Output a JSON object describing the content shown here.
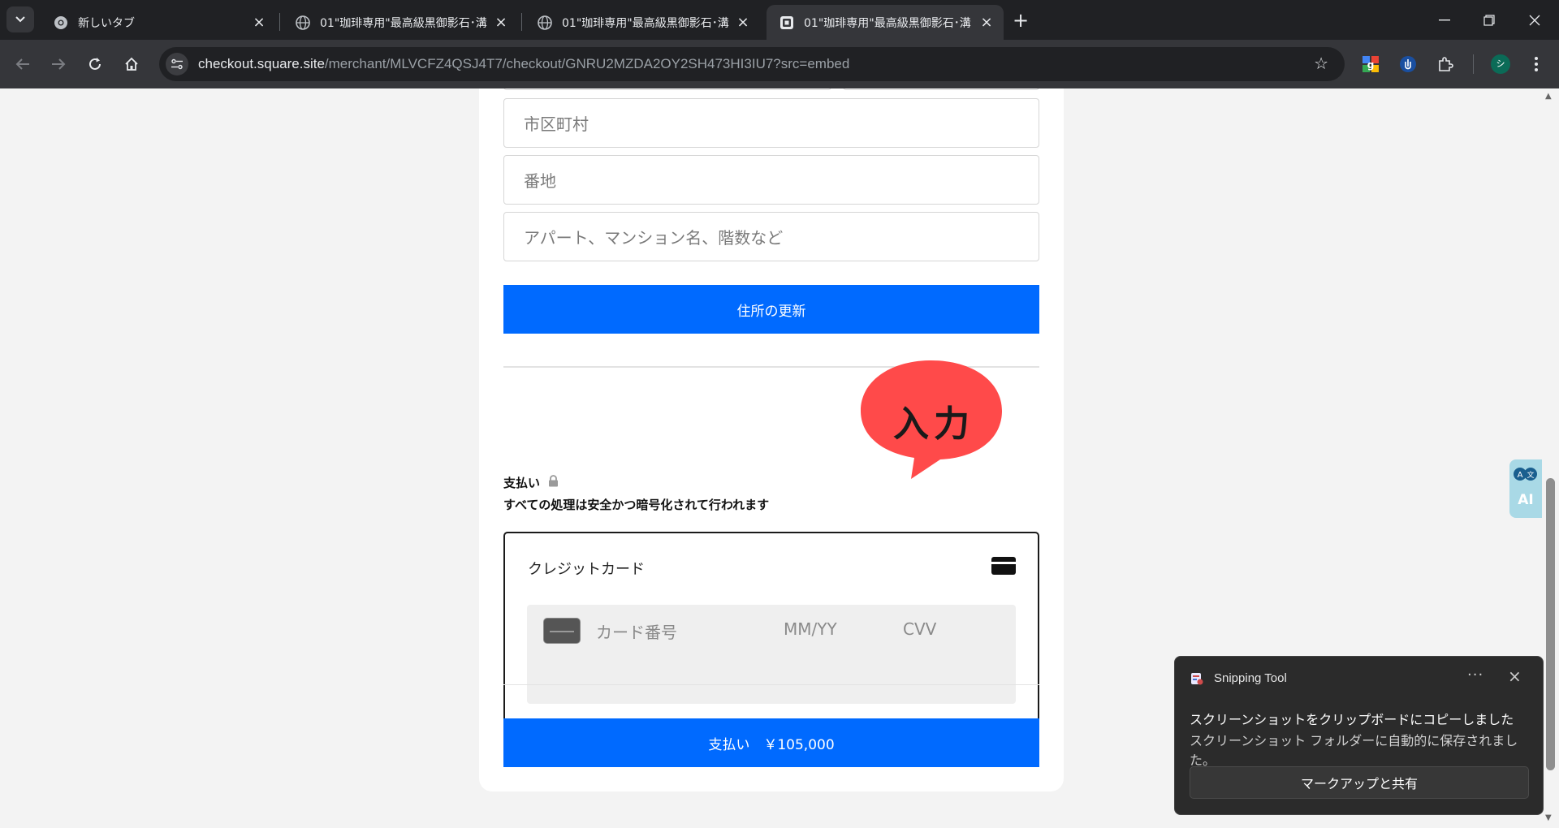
{
  "browser": {
    "tabs": [
      {
        "title": "新しいタブ",
        "favicon": "chrome-icon",
        "active": false
      },
      {
        "title": "01\"珈琲専用\"最高級黒御影石･溝",
        "favicon": "globe-icon",
        "active": false
      },
      {
        "title": "01\"珈琲専用\"最高級黒御影石･溝",
        "favicon": "globe-icon",
        "active": false
      },
      {
        "title": "01\"珈琲専用\"最高級黒御影石･溝",
        "favicon": "square-logo-icon",
        "active": true
      }
    ],
    "url_host": "checkout.square.site",
    "url_path": "/merchant/MLVCFZ4QSJ4T7/checkout/GNRU2MZDA2OY2SH473HI3IU7?src=embed",
    "profile_initial": "シ"
  },
  "address_form": {
    "city_placeholder": "市区町村",
    "street_placeholder": "番地",
    "apartment_placeholder": "アパート、マンション名、階数など",
    "update_button": "住所の更新"
  },
  "payment": {
    "title": "支払い",
    "secure_note": "すべての処理は安全かつ暗号化されて行われます",
    "method_label": "クレジットカード",
    "card_number_placeholder": "カード番号",
    "expiry_placeholder": "MM/YY",
    "cvv_placeholder": "CVV",
    "pay_button": "支払い　￥105,000"
  },
  "annotation": {
    "text": "入力",
    "color": "#ff4a4a"
  },
  "ai_widget": {
    "label": "AI"
  },
  "toast": {
    "app_name": "Snipping Tool",
    "line1": "スクリーンショットをクリップボードにコピーしました",
    "line2": "スクリーンショット フォルダーに自動的に保存されました。",
    "button": "マークアップと共有"
  },
  "colors": {
    "primary": "#006aff",
    "chrome_dark": "#202124",
    "chrome_toolbar": "#35363a"
  }
}
